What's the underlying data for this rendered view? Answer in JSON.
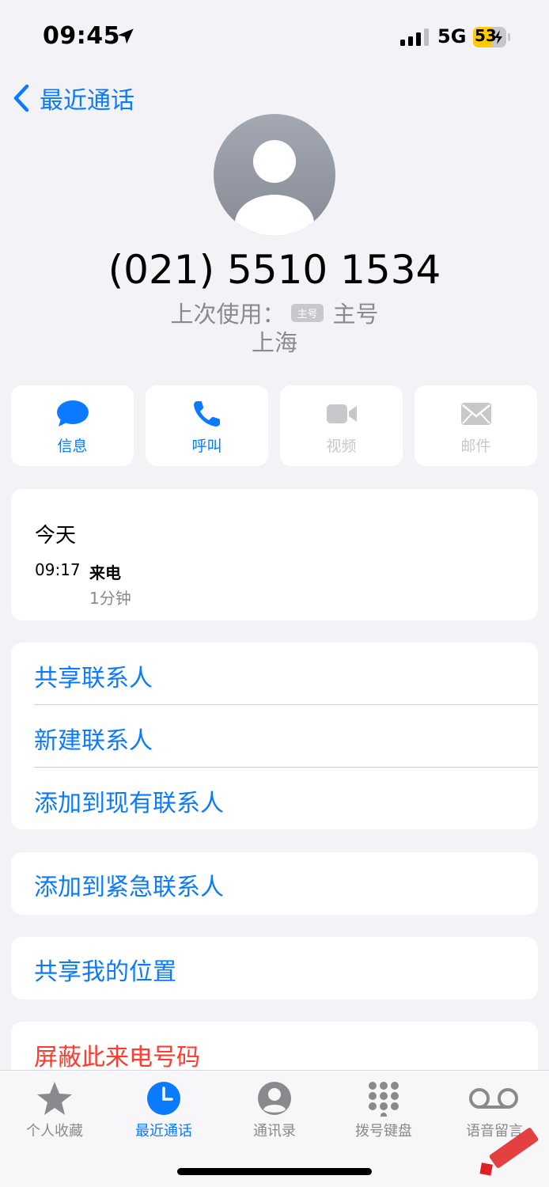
{
  "status": {
    "time": "09:45",
    "network": "5G",
    "battery": "53"
  },
  "nav": {
    "back_label": "最近通话"
  },
  "contact": {
    "phone": "(021) 5510 1534",
    "last_used_prefix": "上次使用：",
    "sim_badge": "主号",
    "last_used_line": "主号",
    "region": "上海"
  },
  "actions": [
    {
      "label": "信息",
      "icon": "message-icon",
      "enabled": true
    },
    {
      "label": "呼叫",
      "icon": "phone-icon",
      "enabled": true
    },
    {
      "label": "视频",
      "icon": "video-icon",
      "enabled": false
    },
    {
      "label": "邮件",
      "icon": "mail-icon",
      "enabled": false
    }
  ],
  "history": {
    "day": "今天",
    "time": "09:17",
    "type": "来电",
    "duration": "1分钟"
  },
  "options": {
    "share_contact": "共享联系人",
    "new_contact": "新建联系人",
    "add_existing": "添加到现有联系人",
    "add_emergency": "添加到紧急联系人",
    "share_location": "共享我的位置",
    "block_caller": "屏蔽此来电号码"
  },
  "tabs": [
    {
      "label": "个人收藏",
      "icon": "star-icon",
      "active": false
    },
    {
      "label": "最近通话",
      "icon": "clock-icon",
      "active": true
    },
    {
      "label": "通讯录",
      "icon": "person-icon",
      "active": false
    },
    {
      "label": "拨号键盘",
      "icon": "keypad-icon",
      "active": false
    },
    {
      "label": "语音留言",
      "icon": "voicemail-icon",
      "active": false
    }
  ],
  "colors": {
    "accent": "#0a7aff",
    "destructive": "#ff3b30",
    "background": "#f2f2f7"
  }
}
